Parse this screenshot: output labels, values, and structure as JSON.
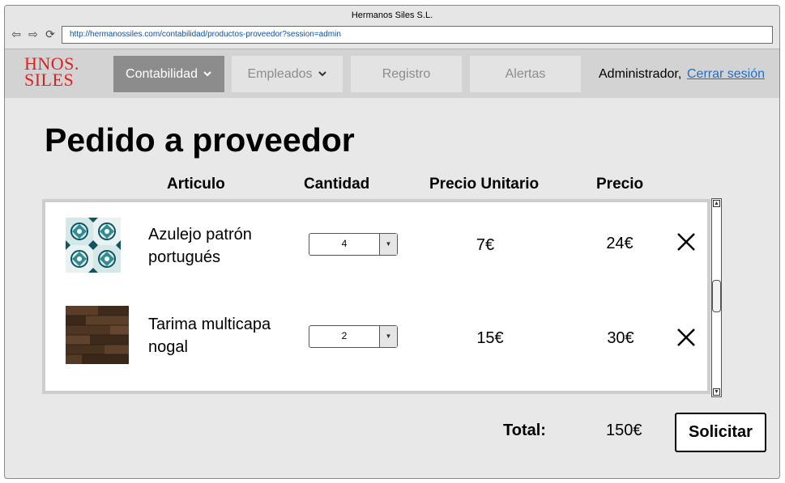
{
  "window": {
    "title": "Hermanos Siles S.L.",
    "url": "http://hermanossiles.com/contabilidad/productos-proveedor?session=admin"
  },
  "nav": {
    "logo_line1": "HNOS.",
    "logo_line2": "SILES",
    "items": [
      {
        "label": "Contabilidad",
        "has_dropdown": true,
        "active": true
      },
      {
        "label": "Empleados",
        "has_dropdown": true,
        "active": false
      },
      {
        "label": "Registro",
        "has_dropdown": false,
        "active": false
      },
      {
        "label": "Alertas",
        "has_dropdown": false,
        "active": false
      }
    ],
    "user": "Administrador,",
    "logout": "Cerrar sesión"
  },
  "page": {
    "title": "Pedido a proveedor",
    "columns": [
      "Articulo",
      "Cantidad",
      "Precio Unitario",
      "Precio"
    ],
    "rows": [
      {
        "name_line1": "Azulejo patrón",
        "name_line2": "portugués",
        "quantity": "4",
        "unit_price": "7€",
        "price": "24€",
        "image": "tile-pattern"
      },
      {
        "name_line1": "Tarima multicapa",
        "name_line2": "nogal",
        "quantity": "2",
        "unit_price": "15€",
        "price": "30€",
        "image": "wood-floor"
      }
    ],
    "total_label": "Total:",
    "total_value": "150€",
    "submit_label": "Solicitar"
  },
  "colors": {
    "active_tab": "#8c8c8c",
    "inactive_tab": "#e3e3e3",
    "logo": "#e02020",
    "link": "#1a6fd6"
  }
}
